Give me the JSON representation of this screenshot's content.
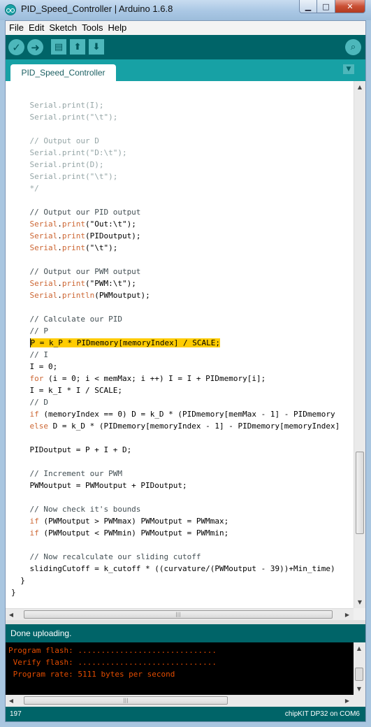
{
  "window": {
    "title": "PID_Speed_Controller | Arduino 1.6.8",
    "minimize_glyph": "▁",
    "maximize_glyph": "□",
    "close_glyph": "✕"
  },
  "menu": [
    "File",
    "Edit",
    "Sketch",
    "Tools",
    "Help"
  ],
  "toolbar": {
    "verify_icon": "check-icon",
    "upload_icon": "arrow-right-icon",
    "new_icon": "new-file-icon",
    "open_icon": "open-icon",
    "save_icon": "save-icon",
    "serial_monitor_icon": "magnifier-icon",
    "verify_glyph": "✓",
    "upload_glyph": "➜",
    "new_glyph": "▤",
    "open_glyph": "⬆",
    "save_glyph": "⬇",
    "serial_glyph": "⌕"
  },
  "tabs": {
    "active": "PID_Speed_Controller",
    "menu_glyph": "▼"
  },
  "editor": {
    "code_lines": [
      [
        {
          "t": "    Serial.print(I);",
          "c": "dim"
        }
      ],
      [
        {
          "t": "    Serial.print(\"\\t\");",
          "c": "dim"
        }
      ],
      [
        {
          "t": "",
          "c": ""
        }
      ],
      [
        {
          "t": "    // Output our D",
          "c": "dim"
        }
      ],
      [
        {
          "t": "    Serial.print(\"D:\\t\");",
          "c": "dim"
        }
      ],
      [
        {
          "t": "    Serial.print(D);",
          "c": "dim"
        }
      ],
      [
        {
          "t": "    Serial.print(\"\\t\");",
          "c": "dim"
        }
      ],
      [
        {
          "t": "    */",
          "c": "dim"
        }
      ],
      [
        {
          "t": "",
          "c": ""
        }
      ],
      [
        {
          "t": "    // Output our PID output",
          "c": "cm"
        }
      ],
      [
        {
          "t": "    ",
          "c": ""
        },
        {
          "t": "Serial",
          "c": "kw"
        },
        {
          "t": ".",
          "c": ""
        },
        {
          "t": "print",
          "c": "kw"
        },
        {
          "t": "(\"Out:\\t\");",
          "c": ""
        }
      ],
      [
        {
          "t": "    ",
          "c": ""
        },
        {
          "t": "Serial",
          "c": "kw"
        },
        {
          "t": ".",
          "c": ""
        },
        {
          "t": "print",
          "c": "kw"
        },
        {
          "t": "(PIDoutput);",
          "c": ""
        }
      ],
      [
        {
          "t": "    ",
          "c": ""
        },
        {
          "t": "Serial",
          "c": "kw"
        },
        {
          "t": ".",
          "c": ""
        },
        {
          "t": "print",
          "c": "kw"
        },
        {
          "t": "(\"\\t\");",
          "c": ""
        }
      ],
      [
        {
          "t": "",
          "c": ""
        }
      ],
      [
        {
          "t": "    // Output our PWM output",
          "c": "cm"
        }
      ],
      [
        {
          "t": "    ",
          "c": ""
        },
        {
          "t": "Serial",
          "c": "kw"
        },
        {
          "t": ".",
          "c": ""
        },
        {
          "t": "print",
          "c": "kw"
        },
        {
          "t": "(\"PWM:\\t\");",
          "c": ""
        }
      ],
      [
        {
          "t": "    ",
          "c": ""
        },
        {
          "t": "Serial",
          "c": "kw"
        },
        {
          "t": ".",
          "c": ""
        },
        {
          "t": "println",
          "c": "kw"
        },
        {
          "t": "(PWMoutput);",
          "c": ""
        }
      ],
      [
        {
          "t": "",
          "c": ""
        }
      ],
      [
        {
          "t": "    // Calculate our PID",
          "c": "cm"
        }
      ],
      [
        {
          "t": "    // P",
          "c": "cm"
        }
      ],
      [
        {
          "t": "    ",
          "c": ""
        },
        {
          "t": "P = k_P * PIDmemory[memoryIndex] / SCALE;",
          "c": "hl"
        }
      ],
      [
        {
          "t": "    // I",
          "c": "cm"
        }
      ],
      [
        {
          "t": "    I = 0;",
          "c": ""
        }
      ],
      [
        {
          "t": "    ",
          "c": ""
        },
        {
          "t": "for",
          "c": "kw"
        },
        {
          "t": " (i = 0; i < memMax; i ++) I = I + PIDmemory[i];",
          "c": ""
        }
      ],
      [
        {
          "t": "    I = k_I * I / SCALE;",
          "c": ""
        }
      ],
      [
        {
          "t": "    // D",
          "c": "cm"
        }
      ],
      [
        {
          "t": "    ",
          "c": ""
        },
        {
          "t": "if",
          "c": "kw"
        },
        {
          "t": " (memoryIndex == 0) D = k_D * (PIDmemory[memMax - 1] - PIDmemory",
          "c": ""
        }
      ],
      [
        {
          "t": "    ",
          "c": ""
        },
        {
          "t": "else",
          "c": "kw"
        },
        {
          "t": " D = k_D * (PIDmemory[memoryIndex - 1] - PIDmemory[memoryIndex]",
          "c": ""
        }
      ],
      [
        {
          "t": "",
          "c": ""
        }
      ],
      [
        {
          "t": "    PIDoutput = P + I + D;",
          "c": ""
        }
      ],
      [
        {
          "t": "",
          "c": ""
        }
      ],
      [
        {
          "t": "    // Increment our PWM",
          "c": "cm"
        }
      ],
      [
        {
          "t": "    PWMoutput = PWMoutput + PIDoutput;",
          "c": ""
        }
      ],
      [
        {
          "t": "",
          "c": ""
        }
      ],
      [
        {
          "t": "    // Now check it's bounds",
          "c": "cm"
        }
      ],
      [
        {
          "t": "    ",
          "c": ""
        },
        {
          "t": "if",
          "c": "kw"
        },
        {
          "t": " (PWMoutput > PWMmax) PWMoutput = PWMmax;",
          "c": ""
        }
      ],
      [
        {
          "t": "    ",
          "c": ""
        },
        {
          "t": "if",
          "c": "kw"
        },
        {
          "t": " (PWMoutput < PWMmin) PWMoutput = PWMmin;",
          "c": ""
        }
      ],
      [
        {
          "t": "",
          "c": ""
        }
      ],
      [
        {
          "t": "    // Now recalculate our sliding cutoff",
          "c": "cm"
        }
      ],
      [
        {
          "t": "    slidingCutoff = k_cutoff * ((curvature/(PWMoutput - 39))+Min_time)",
          "c": ""
        }
      ],
      [
        {
          "t": "  }",
          "c": ""
        }
      ],
      [
        {
          "t": "}",
          "c": ""
        }
      ],
      [
        {
          "t": "",
          "c": ""
        }
      ],
      [
        {
          "t": "/* ~~~~~~~~~~~~~~~~~~~~~~~~~~~~~~~~~~~~~~~~~~~~~~~~~~~~~~~~~~~~~~~~~~~",
          "c": "dim"
        }
      ]
    ]
  },
  "scrollbars": {
    "up_glyph": "▲",
    "down_glyph": "▼",
    "left_glyph": "◀",
    "right_glyph": "▶",
    "grip_glyph": "|||"
  },
  "status": {
    "message": "Done uploading."
  },
  "console": {
    "lines": [
      "Program flash: ..............................",
      " Verify flash: ..............................",
      " Program rate: 5111 bytes per second"
    ]
  },
  "footer": {
    "line_number": "197",
    "board_port": "chipKIT DP32 on COM6"
  },
  "colors": {
    "toolbar": "#006468",
    "tab_bar": "#17a1a5",
    "keyword": "#cc6633",
    "highlight": "#ffcc00",
    "console_text": "#e34c00"
  }
}
